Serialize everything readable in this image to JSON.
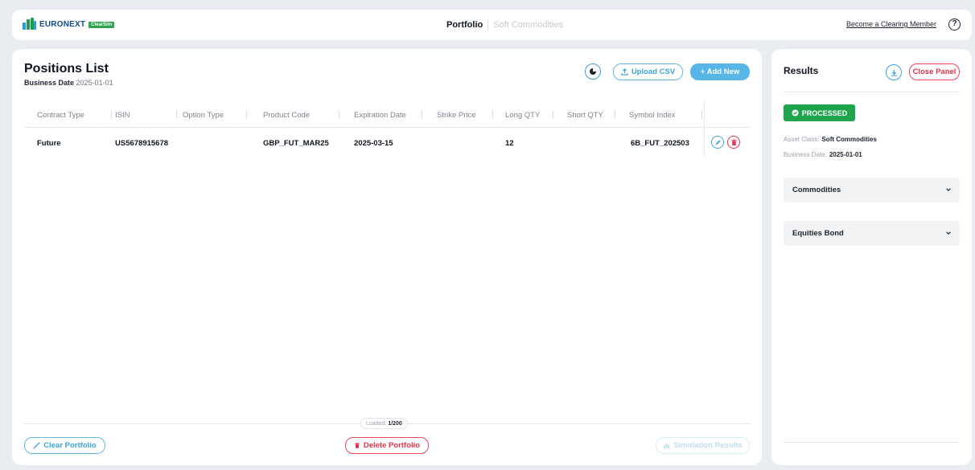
{
  "header": {
    "logo_text": "EURONEXT",
    "logo_badge": "ClearSim",
    "nav_active": "Portfolio",
    "nav_inactive": "Soft Commodities",
    "become_member": "Become a Clearing Member",
    "help_glyph": "?"
  },
  "positions": {
    "title": "Positions List",
    "business_date_label": "Business Date",
    "business_date_value": "2025-01-01",
    "upload_csv_label": "Upload CSV",
    "add_new_label": "+ Add New",
    "columns": [
      "Contract Type",
      "ISIN",
      "Option Type",
      "Product Code",
      "Expiration Date",
      "Strike Price",
      "Long QTY",
      "Short QTY",
      "Symbol Index"
    ],
    "rows": [
      {
        "contract_type": "Future",
        "isin": "US5678915678",
        "option_type": "",
        "product_code": "GBP_FUT_MAR25",
        "expiration_date": "2025-03-15",
        "strike_price": "",
        "long_qty": "12",
        "short_qty": "",
        "symbol_index": "6B_FUT_202503"
      }
    ],
    "loaded_label": "Loaded:",
    "loaded_value": "1/200",
    "clear_portfolio_label": "Clear Portfolio",
    "delete_portfolio_label": "Delete Portfolio",
    "simulation_results_label": "Simulation Results"
  },
  "results": {
    "title": "Results",
    "close_panel_label": "Close Panel",
    "status": "PROCESSED",
    "asset_class_label": "Asset Class:",
    "asset_class_value": "Soft Commodities",
    "business_date_label": "Business Date:",
    "business_date_value": "2025-01-01",
    "sections": [
      "Commodities",
      "Equities Bond"
    ]
  },
  "colors": {
    "accent_blue": "#58b6e6",
    "danger_red": "#e1334a",
    "success_green": "#1ea44c",
    "brand_green": "#1e9a4c",
    "brand_blue": "#0f4c8a"
  }
}
